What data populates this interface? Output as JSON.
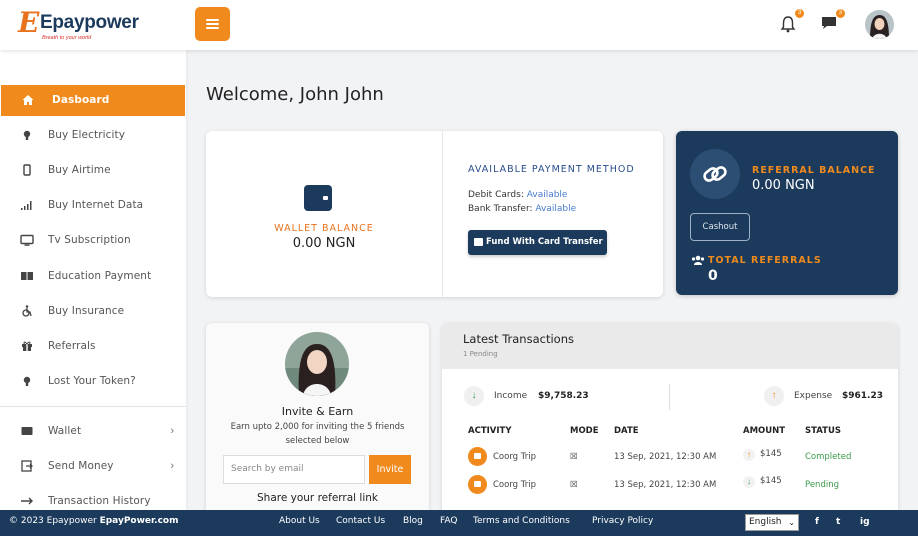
{
  "brand": {
    "name": "Epaypower",
    "logo_letter": "E",
    "tagline": "Breath to your world"
  },
  "header": {
    "notifications_count": "3",
    "messages_count": "3"
  },
  "sidebar": {
    "items": [
      {
        "label": "Dasboard",
        "icon": "home-icon"
      },
      {
        "label": "Buy Electricity",
        "icon": "bulb-icon"
      },
      {
        "label": "Buy Airtime",
        "icon": "phone-icon"
      },
      {
        "label": "Buy Internet Data",
        "icon": "signal-icon"
      },
      {
        "label": "Tv Subscription",
        "icon": "tv-icon"
      },
      {
        "label": "Education Payment",
        "icon": "book-icon"
      },
      {
        "label": "Buy Insurance",
        "icon": "wheelchair-icon"
      },
      {
        "label": "Referrals",
        "icon": "gift-icon"
      },
      {
        "label": "Lost Your Token?",
        "icon": "bulb-icon"
      },
      {
        "label": "Wallet",
        "icon": "wallet-icon"
      },
      {
        "label": "Send Money",
        "icon": "send-icon"
      },
      {
        "label": "Transaction History",
        "icon": "arrow-icon"
      }
    ]
  },
  "welcome": {
    "text": "Welcome, John John"
  },
  "wallet": {
    "label": "WALLET BALANCE",
    "value": "0.00 NGN"
  },
  "payment_methods": {
    "title": "AVAILABLE PAYMENT METHOD",
    "debit_label": "Debit Cards:",
    "debit_status": "Available",
    "bank_label": "Bank Transfer:",
    "bank_status": "Available",
    "fund_button": "Fund With Card Transfer"
  },
  "referral": {
    "balance_label": "REFERRAL BALANCE",
    "balance_value": "0.00 NGN",
    "cashout_button": "Cashout",
    "total_label": "TOTAL REFERRALS",
    "total_value": "0"
  },
  "invite": {
    "title": "Invite & Earn",
    "description": "Earn upto 2,000 for inviting the 5 friends selected below",
    "input_placeholder": "Search by email",
    "button": "Invite",
    "share_text": "Share your referral link"
  },
  "transactions": {
    "title": "Latest Transactions",
    "subtitle": "1 Pending",
    "income_label": "Income",
    "income_value": "$9,758.23",
    "expense_label": "Expense",
    "expense_value": "$961.23",
    "columns": [
      "ACTIVITY",
      "MODE",
      "DATE",
      "AMOUNT",
      "STATUS"
    ],
    "rows": [
      {
        "activity": "Coorg Trip",
        "mode": "☒",
        "date": "13 Sep, 2021, 12:30 AM",
        "amount": "$145",
        "status": "Completed"
      },
      {
        "activity": "Coorg Trip",
        "mode": "☒",
        "date": "13 Sep, 2021, 12:30 AM",
        "amount": "$145",
        "status": "Pending"
      }
    ]
  },
  "footer": {
    "copyright": "© 2023 Epaypower",
    "site": "EpayPower.com",
    "links": [
      "About Us",
      "Contact Us",
      "Blog",
      "FAQ",
      "Terms and Conditions",
      "Privacy Policy"
    ],
    "language": "English",
    "social": [
      "f",
      "t",
      "ig"
    ]
  },
  "colors": {
    "accent": "#f08a1c",
    "navy": "#1b3a5c",
    "success": "#3a9a4a"
  }
}
